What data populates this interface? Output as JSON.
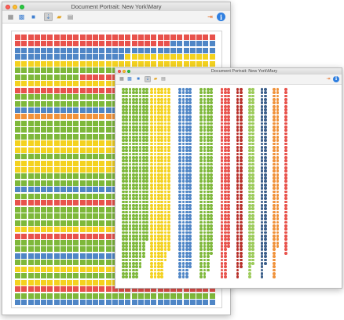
{
  "colors": {
    "red": "#e8524c",
    "blue": "#4f86c6",
    "yellow": "#f4d21f",
    "green": "#7eb83a",
    "dark_red": "#b8312b",
    "light_green": "#9ccb5a",
    "dark_blue": "#3c5f8a",
    "orange": "#f0923a"
  },
  "back_window": {
    "title": "Document Portrait: New York\\Mary",
    "toolbar_buttons": [
      {
        "name": "portrait-view-icon",
        "glyph": "▦",
        "color": "#777777",
        "active": false
      },
      {
        "name": "mosaic-view-icon",
        "glyph": "▩",
        "color": "#3f7fd0",
        "active": false
      },
      {
        "name": "grid-view-icon",
        "glyph": "■",
        "color": "#3f7fd0",
        "active": false
      },
      {
        "name": "sort-icon",
        "glyph": "⇣",
        "color": "#4f86c6",
        "active": true
      },
      {
        "name": "folder-icon",
        "glyph": "▰",
        "color": "#e2a21f",
        "active": false
      },
      {
        "name": "export-icon",
        "glyph": "▤",
        "color": "#7d7d7d",
        "active": false
      },
      {
        "name": "exit-icon",
        "glyph": "⇥",
        "color": "#e56a1f",
        "active": false
      },
      {
        "name": "info-icon",
        "glyph": "i",
        "color": "#ffffff",
        "active": false
      }
    ],
    "rows": [
      "RRRRRRRRRRRRRRRRRRRRRRRRRRRRRRR",
      "RRRRRRRRRRRRRRRRRRRRRRRRBBBBBBB",
      "BBBBBBBBBBBBBBBBBBBBBBBBBBBBBBB",
      "BBBBBBBBBBBBBBBBBYYYYYYYYYYYYYY",
      "YYYYYYYYYYYYYYYYYYYYYYYYYYYYYYY",
      "GGGGGGGGGGGGGGGGGGGGGGGGGGGGGGG",
      "GGGGGGGGGGRRRRRRRRRRRRRRRRRRRRR",
      "YYYYYYYYYYYYYYYYYYYYYYYYYYYYYYY",
      "RRRRRRRRRRRRRRRRRRRRRRRRRRRRRRR",
      "GGGGGGGGGGGGGGGGGGGGGGGGGGGGGGG",
      "GGGGGGGGGGGGGGGGGGGGGGGGGGGGGGG",
      "BBBBBBBBBBBBBBBBBBBBBBBBBBBBBBB",
      "OOOOOOOOOOOOOOOOOOOOOOOOOOOOOOO",
      "GGGGGGGGGGGGGGGGGGGGGGGGGGGGGGG",
      "GGGGGGGGGGGGGGGGGGGGGGGGGGGGGGG",
      "GGGGGGGGGGGGGGGGGGGGGGGGGGGGGGG",
      "YYYYYYYYYYYYYYYYYYYYYYYYYYYYYYY",
      "YYYYYYYYYYYYYYYYYYYYYYYYYYYYYYY",
      "GGGGGGGGGGGGGGGGGGGGGGGGGGGGGGG",
      "YYYYYYYYYYYYYYYYYYYYYYYYYYYYYYY",
      "YYYYYYYYYYYYYYYYYYYYYYYYYYYYYYY",
      "GGGGGGGGGGGGGGGGGGGGGGGGGGGGGGG",
      "GGGGGGGGGGGGGGGGGGGGGGGGGGGGGGG",
      "BBBBBBBBBBBBBBBBBBBBBBBBBBBBBBB",
      "GGGGGGGGGGGGGGGGGGGGGGGGGGGGGGG",
      "RRRRRRRRRRRRRRRRRRRRRRRRRRRRRRR",
      "GGGGGGGGGGGGGGGGGGGGGGGGGGGGGGG",
      "GGGGGGGGGGGGGGGGGGGGGGRRRRRRRRR",
      "GGGGGGGGGGGGGGGGGGGGGGGGGGGGGGG",
      "YYYYYYYYYYYYYYYYYYYYYYYYYYYYYYY",
      "RRRRRRRRRRRRRRRRRRRRRRRRRRRRRRR",
      "GGGGGGGGGGGGGGGGGGGGGGGGGGGGGGG",
      "GGGGGGGGGGGGGGGGGGGGGGGGGGGGGGG",
      "BBBBBBBBBBBBBBBBBBBBBBBBBBBBBBB",
      "GGGGGGGGGGGGGGGGGGGGGGGGGGGGGGG",
      "YYYYYYYYYYYYYYYYYYYYYYYYYYYYYYY",
      "GGGGGGGGGGGGGGGGGGGGGGGGGGGGGGG",
      "YYYYYYYYYYYYYYYYYYYYYYYYYYYYYYY",
      "RRRRRRRRRRRRRRRRRRRRRRRRRRRRRRR",
      "GGGGGGGGGGGGGGGGGGGGGGGGGGGGGGG",
      "BBBBBBBBBBBBBBBBBBBBBBBBBBBBBBB"
    ]
  },
  "front_window": {
    "title": "Document Portrait: New York\\Mary",
    "toolbar_buttons": [
      {
        "name": "portrait-view-icon",
        "glyph": "▦",
        "color": "#777777",
        "active": false
      },
      {
        "name": "mosaic-view-icon",
        "glyph": "▩",
        "color": "#3f7fd0",
        "active": false
      },
      {
        "name": "grid-view-icon",
        "glyph": "■",
        "color": "#3f7fd0",
        "active": false
      },
      {
        "name": "sort-icon",
        "glyph": "⇣",
        "color": "#4f86c6",
        "active": true
      },
      {
        "name": "folder-icon",
        "glyph": "▰",
        "color": "#e2a21f",
        "active": false
      },
      {
        "name": "export-icon",
        "glyph": "▤",
        "color": "#7d7d7d",
        "active": false
      },
      {
        "name": "exit-icon",
        "glyph": "⇥",
        "color": "#e56a1f",
        "active": false
      },
      {
        "name": "info-icon",
        "glyph": "i",
        "color": "#ffffff",
        "active": false
      }
    ],
    "columns": [
      {
        "color": "green",
        "rows": 56
      },
      {
        "color": "green",
        "rows": 56
      },
      {
        "color": "green",
        "rows": 56
      },
      {
        "color": "green",
        "rows": 56
      },
      {
        "color": "green",
        "rows": 56
      },
      {
        "color": "green",
        "rows": 53
      },
      {
        "color": "green",
        "rows": 50
      },
      {
        "color": "green",
        "rows": 45
      },
      {
        "color": "yellow",
        "rows": 56
      },
      {
        "color": "yellow",
        "rows": 56
      },
      {
        "color": "yellow",
        "rows": 56
      },
      {
        "color": "yellow",
        "rows": 56
      },
      {
        "color": "yellow",
        "rows": 51
      },
      {
        "color": "yellow",
        "rows": 48
      },
      {
        "color": "blue",
        "rows": 56
      },
      {
        "color": "blue",
        "rows": 56
      },
      {
        "color": "blue",
        "rows": 56
      },
      {
        "color": "blue",
        "rows": 53
      },
      {
        "color": "green",
        "rows": 56
      },
      {
        "color": "green",
        "rows": 56
      },
      {
        "color": "green",
        "rows": 54
      },
      {
        "color": "green",
        "rows": 49
      },
      {
        "color": "red",
        "rows": 56
      },
      {
        "color": "red",
        "rows": 56
      },
      {
        "color": "red",
        "rows": 47
      },
      {
        "color": "dark_red",
        "rows": 56
      },
      {
        "color": "dark_red",
        "rows": 53
      },
      {
        "color": "light_green",
        "rows": 56
      },
      {
        "color": "light_green",
        "rows": 52
      },
      {
        "color": "dark_blue",
        "rows": 56
      },
      {
        "color": "dark_blue",
        "rows": 52
      },
      {
        "color": "orange",
        "rows": 56
      },
      {
        "color": "orange",
        "rows": 47
      },
      {
        "color": "red",
        "rows": 49
      }
    ]
  }
}
